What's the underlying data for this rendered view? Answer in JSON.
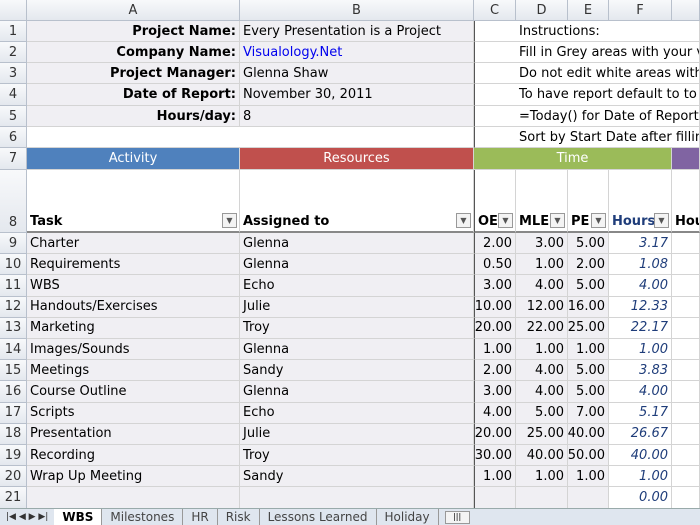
{
  "columns": [
    "A",
    "B",
    "C",
    "D",
    "E",
    "F"
  ],
  "info": [
    {
      "label": "Project Name:",
      "value": "Every Presentation is a Project"
    },
    {
      "label": "Company Name:",
      "value": "Visualology.Net"
    },
    {
      "label": "Project Manager:",
      "value": "Glenna Shaw"
    },
    {
      "label": "Date of Report:",
      "value": "November 30, 2011"
    },
    {
      "label": "Hours/day:",
      "value": "8"
    }
  ],
  "instructions": [
    "Instructions:",
    "Fill in Grey areas with your v",
    "Do not edit white areas with",
    "To have report default to to",
    "=Today() for Date of Report",
    "Sort by Start Date after fillin"
  ],
  "bands": {
    "activity": "Activity",
    "resources": "Resources",
    "time": "Time"
  },
  "colors": {
    "activity": "#4f81bd",
    "resources": "#c0504d",
    "time": "#9bbb59",
    "other": "#8064a2"
  },
  "headers": {
    "task": "Task",
    "assigned": "Assigned to",
    "oe": "OE",
    "mle": "MLE",
    "pe": "PE",
    "hours": "Hours",
    "next": "Hou"
  },
  "rows": [
    {
      "n": "9",
      "task": "Charter",
      "who": "Glenna",
      "oe": "2.00",
      "mle": "3.00",
      "pe": "5.00",
      "h": "3.17"
    },
    {
      "n": "10",
      "task": "Requirements",
      "who": "Glenna",
      "oe": "0.50",
      "mle": "1.00",
      "pe": "2.00",
      "h": "1.08"
    },
    {
      "n": "11",
      "task": "WBS",
      "who": "Echo",
      "oe": "3.00",
      "mle": "4.00",
      "pe": "5.00",
      "h": "4.00"
    },
    {
      "n": "12",
      "task": "Handouts/Exercises",
      "who": "Julie",
      "oe": "10.00",
      "mle": "12.00",
      "pe": "16.00",
      "h": "12.33"
    },
    {
      "n": "13",
      "task": "Marketing",
      "who": "Troy",
      "oe": "20.00",
      "mle": "22.00",
      "pe": "25.00",
      "h": "22.17"
    },
    {
      "n": "14",
      "task": "Images/Sounds",
      "who": "Glenna",
      "oe": "1.00",
      "mle": "1.00",
      "pe": "1.00",
      "h": "1.00"
    },
    {
      "n": "15",
      "task": "Meetings",
      "who": "Sandy",
      "oe": "2.00",
      "mle": "4.00",
      "pe": "5.00",
      "h": "3.83"
    },
    {
      "n": "16",
      "task": "Course Outline",
      "who": "Glenna",
      "oe": "3.00",
      "mle": "4.00",
      "pe": "5.00",
      "h": "4.00"
    },
    {
      "n": "17",
      "task": "Scripts",
      "who": "Echo",
      "oe": "4.00",
      "mle": "5.00",
      "pe": "7.00",
      "h": "5.17"
    },
    {
      "n": "18",
      "task": "Presentation",
      "who": "Julie",
      "oe": "20.00",
      "mle": "25.00",
      "pe": "40.00",
      "h": "26.67"
    },
    {
      "n": "19",
      "task": "Recording",
      "who": "Troy",
      "oe": "30.00",
      "mle": "40.00",
      "pe": "50.00",
      "h": "40.00"
    },
    {
      "n": "20",
      "task": "Wrap Up Meeting",
      "who": "Sandy",
      "oe": "1.00",
      "mle": "1.00",
      "pe": "1.00",
      "h": "1.00"
    },
    {
      "n": "21",
      "task": "",
      "who": "",
      "oe": "",
      "mle": "",
      "pe": "",
      "h": "0.00"
    }
  ],
  "tabs": [
    "WBS",
    "Milestones",
    "HR",
    "Risk",
    "Lessons Learned",
    "Holiday"
  ]
}
